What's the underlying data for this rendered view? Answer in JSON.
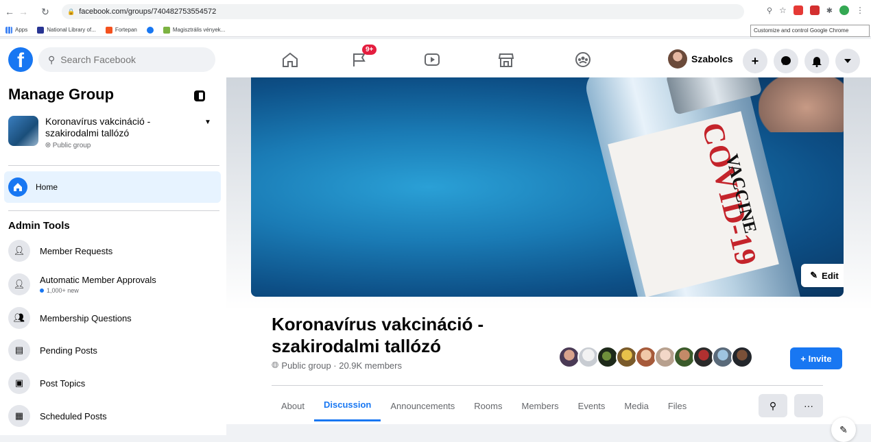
{
  "browser": {
    "url": "facebook.com/groups/740482753554572",
    "bookmarks": [
      "Apps",
      "National Library of...",
      "Fortepan",
      "Magisztrális vények..."
    ],
    "tooltip": "Customize and control Google Chrome"
  },
  "header": {
    "search_placeholder": "Search Facebook",
    "notification_count": "9+",
    "profile_name": "Szabolcs"
  },
  "sidebar": {
    "title": "Manage Group",
    "group_name": "Koronavírus vakcináció - szakirodalmi tallózó",
    "group_privacy": "Public group",
    "home_label": "Home",
    "admin_tools_title": "Admin Tools",
    "tools": [
      {
        "label": "Member Requests",
        "sub": ""
      },
      {
        "label": "Automatic Member Approvals",
        "sub": "1,000+ new"
      },
      {
        "label": "Membership Questions",
        "sub": ""
      },
      {
        "label": "Pending Posts",
        "sub": ""
      },
      {
        "label": "Post Topics",
        "sub": ""
      },
      {
        "label": "Scheduled Posts",
        "sub": ""
      }
    ]
  },
  "cover": {
    "text_main": "COVID-19",
    "text_sub": "VACCINE",
    "edit_label": "Edit"
  },
  "group": {
    "title_line1": "Koronavírus vakcináció -",
    "title_line2": "szakirodalmi tallózó",
    "meta": "Public group · 20.9K members",
    "invite_label": "+ Invite"
  },
  "tabs": [
    "About",
    "Discussion",
    "Announcements",
    "Rooms",
    "Members",
    "Events",
    "Media",
    "Files"
  ],
  "more_label": "···",
  "colors": {
    "accent": "#1877f2",
    "badge": "#e41e3f",
    "active_bg": "#e7f3ff"
  }
}
